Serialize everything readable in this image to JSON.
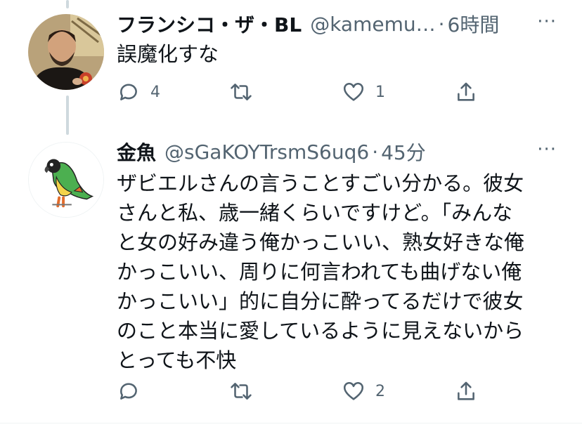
{
  "tweets": [
    {
      "name": "フランシコ・ザ・BL",
      "handle": "@kamemu…",
      "dot": "·",
      "time": "6時間",
      "more": "···",
      "body": "誤魔化すな",
      "replies": "4",
      "retweets": "",
      "likes": "1",
      "avatar_icon": "saint-portrait-avatar"
    },
    {
      "name": "金魚",
      "handle": "@sGaKOYTrsmS6uq6",
      "dot": "·",
      "time": "45分",
      "more": "···",
      "body": "ザビエルさんの言うことすごい分かる。彼女\nさんと私、歳一緒くらいですけど。「みんな\nと女の好み違う俺かっこいい、熟女好きな俺\nかっこいい、周りに何言われても曲げない俺\nかっこいい」的に自分に酔ってるだけで彼女\nのこと本当に愛しているように見えないから\nとっても不快",
      "replies": "",
      "retweets": "",
      "likes": "2",
      "avatar_icon": "parrot-avatar"
    }
  ],
  "colors": {
    "text": "#0f1419",
    "secondary": "#536471",
    "thread_line": "#cfd9de",
    "divider": "#eff3f4"
  }
}
